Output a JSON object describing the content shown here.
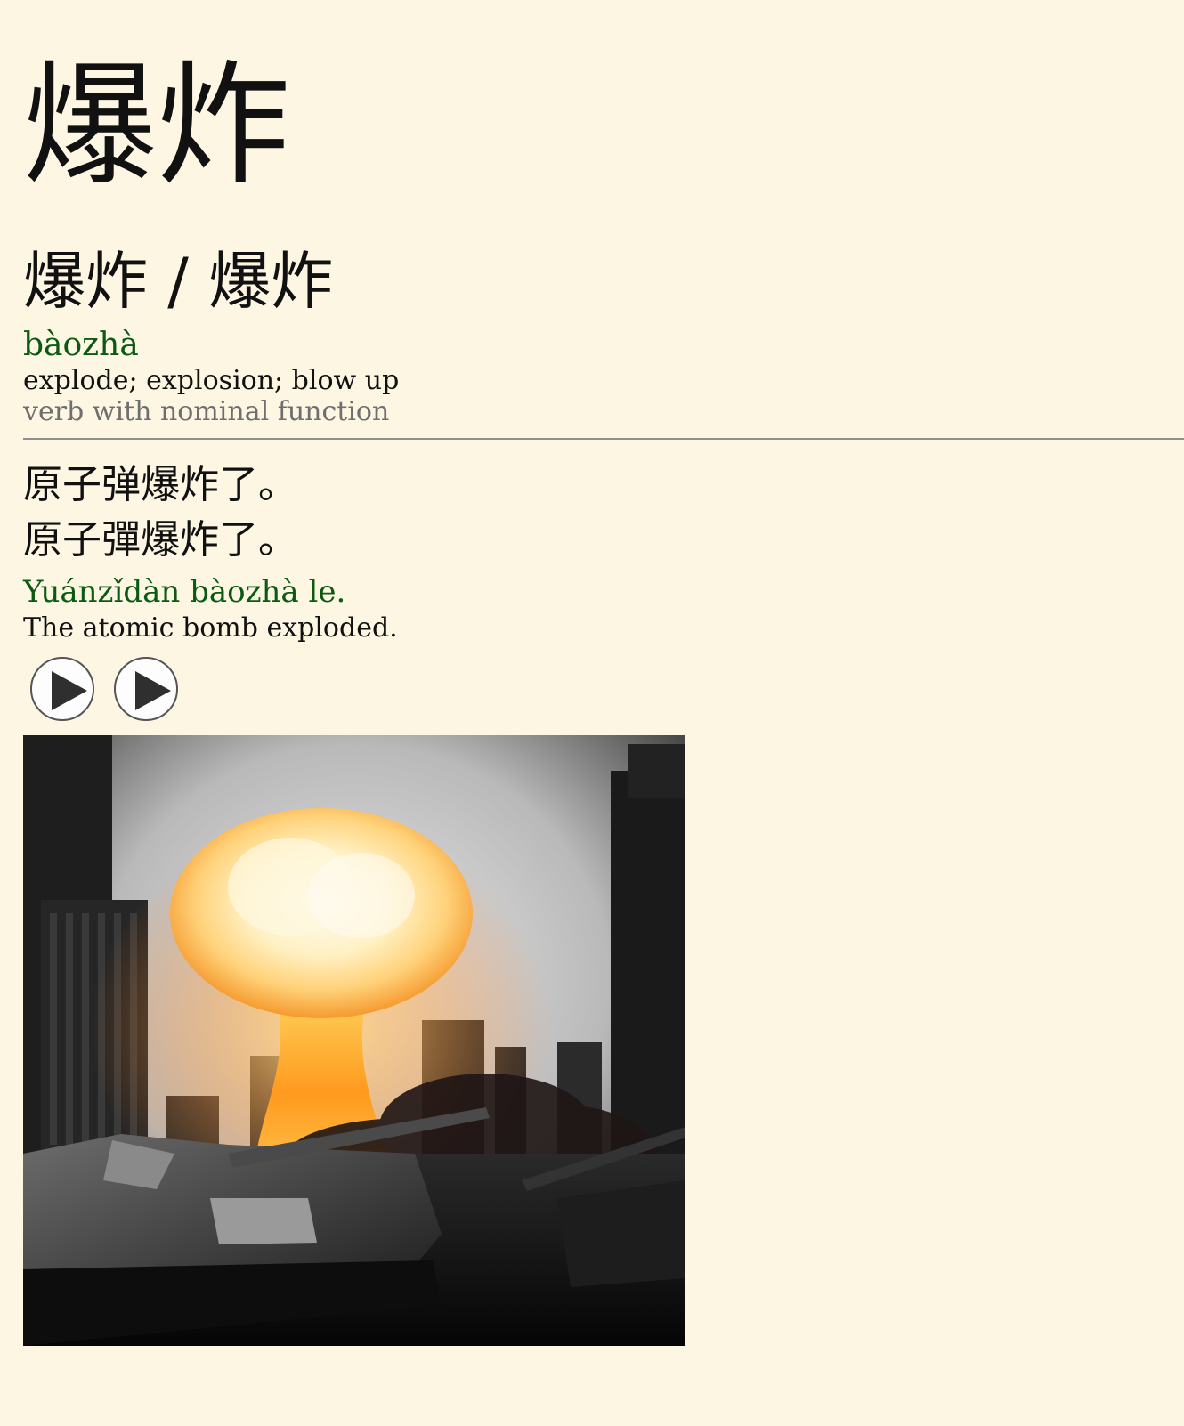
{
  "entry": {
    "headword": "爆炸",
    "forms": "爆炸 / 爆炸",
    "pinyin": "bàozhà",
    "definition": "explode; explosion; blow up",
    "part_of_speech": "verb with nominal function"
  },
  "example": {
    "simplified": "原子弹爆炸了。",
    "traditional": "原子彈爆炸了。",
    "pinyin": "Yuánzǐdàn bàozhà le.",
    "translation": "The atomic bomb exploded."
  },
  "audio": {
    "buttons": [
      {
        "icon": "play-icon"
      },
      {
        "icon": "play-icon"
      }
    ]
  },
  "colors": {
    "background": "#fdf6e3",
    "pinyin": "#0b5a12",
    "secondary": "#6e6e6e",
    "divider": "#8f8f8f"
  },
  "image": {
    "subject": "mushroom-cloud-explosion-over-city-with-tanks"
  }
}
